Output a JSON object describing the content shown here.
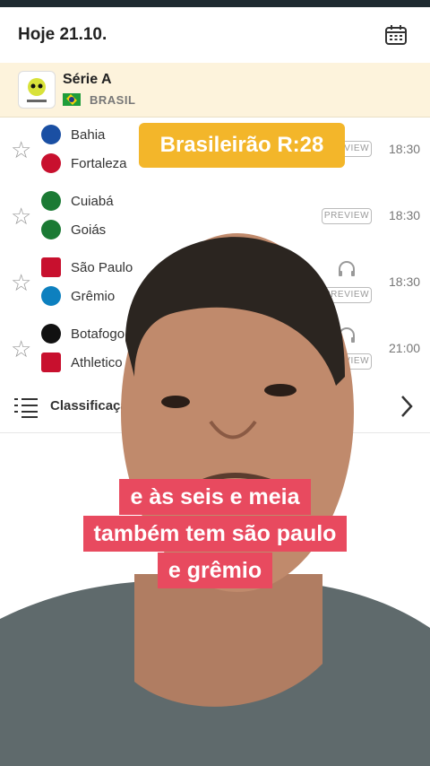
{
  "header": {
    "date": "Hoje 21.10.",
    "calendar_icon": "calendar-icon"
  },
  "league": {
    "name": "Série A",
    "country": "BRASIL",
    "flag_icon": "brazil-flag-icon"
  },
  "matches": [
    {
      "home": "Bahia",
      "away": "Fortaleza",
      "preview": "PREVIEW",
      "time": "18:30",
      "home_color": "#1a4fa3",
      "away_color": "#c8102e"
    },
    {
      "home": "Cuiabá",
      "away": "Goiás",
      "preview": "PREVIEW",
      "time": "18:30",
      "home_color": "#1b7a34",
      "away_color": "#1b7a34"
    },
    {
      "home": "São Paulo",
      "away": "Grêmio",
      "preview": "PREVIEW",
      "time": "18:30",
      "home_color": "#c8102e",
      "away_color": "#0d80bf"
    },
    {
      "home": "Botafogo",
      "away": "Athletico",
      "preview": "PREVIEW",
      "time": "21:00",
      "home_color": "#111111",
      "away_color": "#c8102e"
    }
  ],
  "standings": {
    "label": "Classificação"
  },
  "overlay": {
    "banner": "Brasileirão R:28",
    "caption": [
      "e às seis e meia",
      "também tem são paulo",
      "e grêmio"
    ]
  },
  "colors": {
    "league_bg": "#fdf3dc",
    "banner": "#f3b62a",
    "caption": "#e84a5f"
  }
}
